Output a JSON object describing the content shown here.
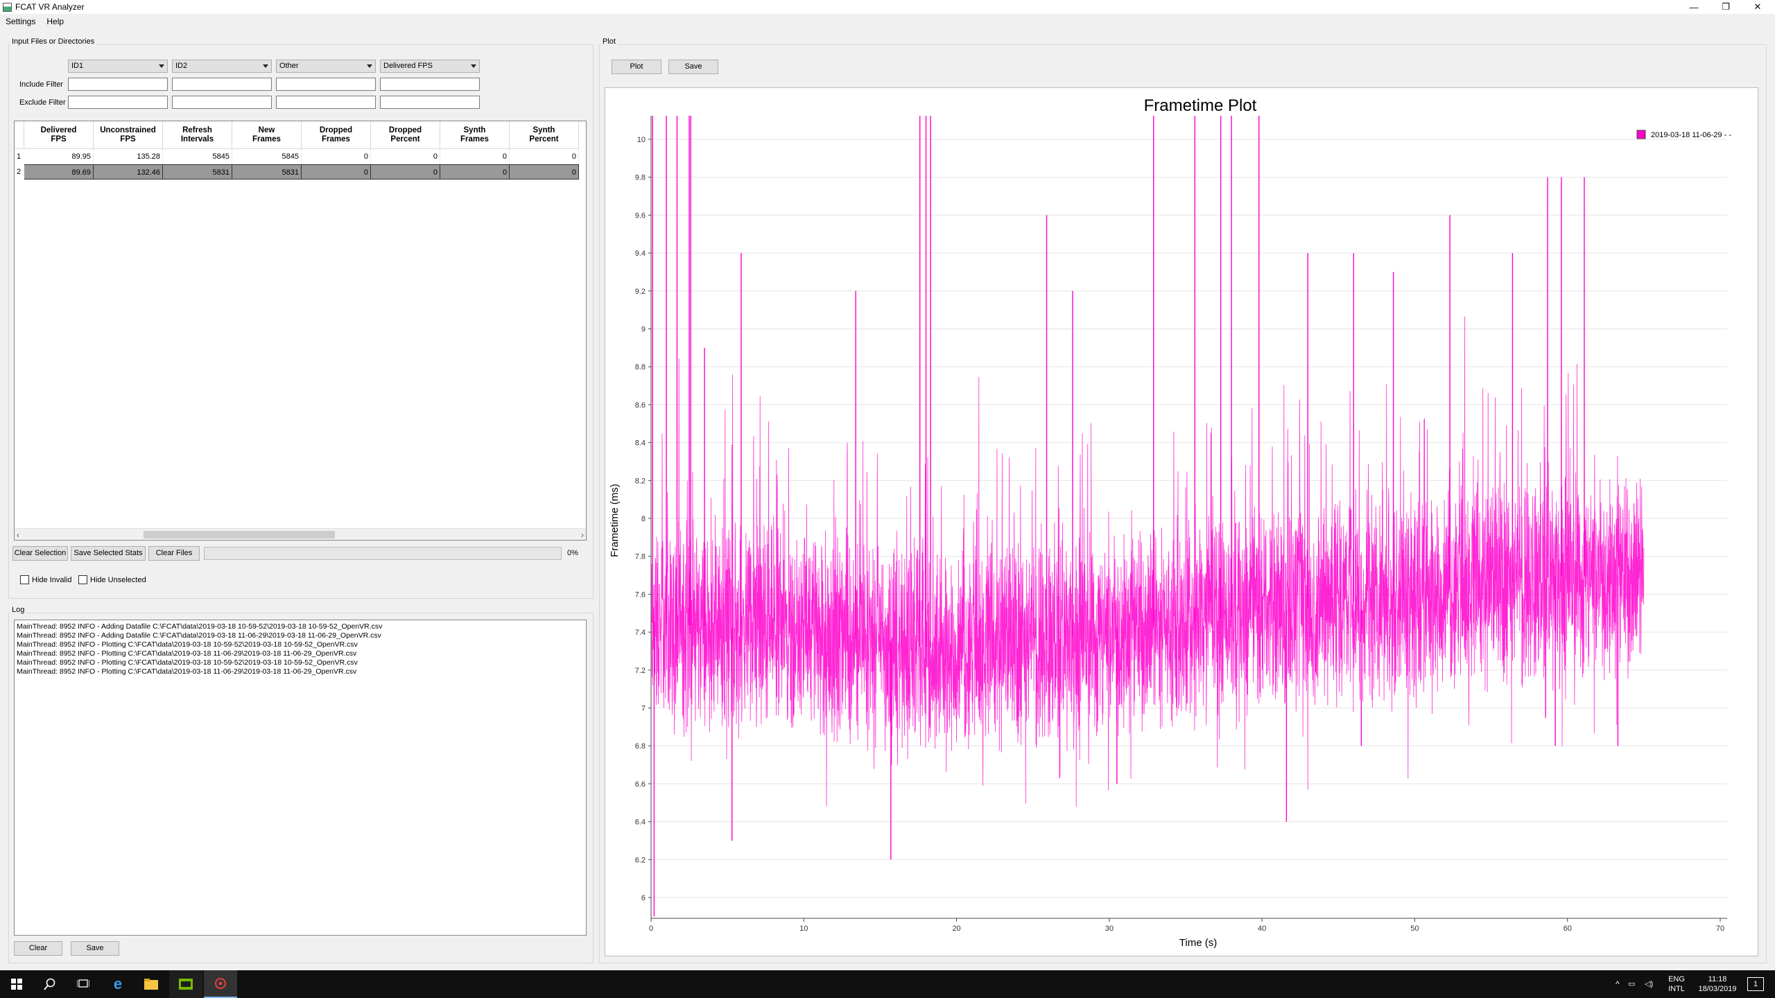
{
  "window": {
    "title": "FCAT VR Analyzer",
    "minimize": "—",
    "restore": "❐",
    "close": "✕"
  },
  "menu": [
    {
      "label": "Settings"
    },
    {
      "label": "Help"
    }
  ],
  "input_group": {
    "title": "Input Files or Directories",
    "combos": [
      "ID1",
      "ID2",
      "Other",
      "Delivered FPS"
    ],
    "include_label": "Include Filter",
    "exclude_label": "Exclude Filter",
    "include_values": [
      "",
      "",
      "",
      ""
    ],
    "exclude_values": [
      "",
      "",
      "",
      ""
    ]
  },
  "table": {
    "headers": [
      [
        "Delivered",
        "FPS"
      ],
      [
        "Unconstrained",
        "FPS"
      ],
      [
        "Refresh",
        "Intervals"
      ],
      [
        "New",
        "Frames"
      ],
      [
        "Dropped",
        "Frames"
      ],
      [
        "Dropped",
        "Percent"
      ],
      [
        "Synth",
        "Frames"
      ],
      [
        "Synth",
        "Percent"
      ]
    ],
    "rows": [
      {
        "id": "1",
        "cells": [
          "89.95",
          "135.28",
          "5845",
          "5845",
          "0",
          "0",
          "0",
          "0"
        ],
        "selected": false
      },
      {
        "id": "2",
        "cells": [
          "89.69",
          "132.46",
          "5831",
          "5831",
          "0",
          "0",
          "0",
          "0"
        ],
        "selected": true
      }
    ]
  },
  "buttons": {
    "clear_selection": "Clear Selection",
    "save_selected": "Save Selected Stats",
    "clear_files": "Clear Files",
    "plot": "Plot",
    "save_plot": "Save",
    "log_clear": "Clear",
    "log_save": "Save"
  },
  "progress": {
    "label": "0%",
    "value": 0
  },
  "checkboxes": {
    "hide_invalid": "Hide Invalid",
    "hide_unselected": "Hide Unselected"
  },
  "log": {
    "title": "Log",
    "lines": [
      "MainThread:  8952  INFO - Adding Datafile C:\\FCAT\\data\\2019-03-18 10-59-52\\2019-03-18 10-59-52_OpenVR.csv",
      "MainThread:  8952  INFO - Adding Datafile C:\\FCAT\\data\\2019-03-18 11-06-29\\2019-03-18 11-06-29_OpenVR.csv",
      "MainThread:  8952  INFO - Plotting C:\\FCAT\\data\\2019-03-18 10-59-52\\2019-03-18 10-59-52_OpenVR.csv",
      "MainThread:  8952  INFO - Plotting C:\\FCAT\\data\\2019-03-18 11-06-29\\2019-03-18 11-06-29_OpenVR.csv",
      "MainThread:  8952  INFO - Plotting C:\\FCAT\\data\\2019-03-18 10-59-52\\2019-03-18 10-59-52_OpenVR.csv",
      "MainThread:  8952  INFO - Plotting C:\\FCAT\\data\\2019-03-18 11-06-29\\2019-03-18 11-06-29_OpenVR.csv"
    ]
  },
  "plot_group": {
    "title": "Plot"
  },
  "chart_data": {
    "type": "line",
    "title": "Frametime Plot",
    "xlabel": "Time (s)",
    "ylabel": "Frametime (ms)",
    "xlim": [
      0,
      70
    ],
    "ylim": [
      5.9,
      10.2
    ],
    "x_ticks": [
      0,
      10,
      20,
      30,
      40,
      50,
      60,
      70
    ],
    "y_ticks": [
      6,
      6.2,
      6.4,
      6.6,
      6.8,
      7,
      7.2,
      7.4,
      7.6,
      7.8,
      8,
      8.2,
      8.4,
      8.6,
      8.8,
      9,
      9.2,
      9.4,
      9.6,
      9.8,
      10
    ],
    "grid": true,
    "legend_position": "top-right",
    "series": [
      {
        "name": "2019-03-18 11-06-29 - -",
        "color": "#ff00cc",
        "x_range": [
          0,
          65
        ],
        "baseline_trend": [
          [
            0,
            7.45
          ],
          [
            10,
            7.4
          ],
          [
            20,
            7.3
          ],
          [
            30,
            7.4
          ],
          [
            40,
            7.5
          ],
          [
            50,
            7.6
          ],
          [
            60,
            7.7
          ],
          [
            65,
            7.7
          ]
        ],
        "spikes": [
          [
            0.1,
            10.2
          ],
          [
            1,
            10.2
          ],
          [
            1.7,
            10.2
          ],
          [
            2.5,
            10.2
          ],
          [
            2.6,
            10.2
          ],
          [
            3.5,
            8.9
          ],
          [
            5.9,
            9.4
          ],
          [
            13.4,
            9.2
          ],
          [
            17.6,
            10.2
          ],
          [
            18,
            10.2
          ],
          [
            18.3,
            10.2
          ],
          [
            25.9,
            9.6
          ],
          [
            27.6,
            9.2
          ],
          [
            32.9,
            10.2
          ],
          [
            35.6,
            10.2
          ],
          [
            37.3,
            10.2
          ],
          [
            38,
            10.2
          ],
          [
            39.8,
            10.2
          ],
          [
            43,
            9.4
          ],
          [
            46,
            9.4
          ],
          [
            48.6,
            9.3
          ],
          [
            52.3,
            9.6
          ],
          [
            56.4,
            9.4
          ],
          [
            58.7,
            9.8
          ],
          [
            59.6,
            9.8
          ],
          [
            61.1,
            9.8
          ]
        ],
        "dips": [
          [
            0.2,
            5.9
          ],
          [
            5.3,
            6.3
          ],
          [
            15.7,
            6.2
          ],
          [
            30.5,
            6.6
          ],
          [
            41.6,
            6.4
          ],
          [
            46.5,
            6.8
          ],
          [
            59.2,
            6.8
          ],
          [
            63.3,
            6.8
          ]
        ]
      }
    ]
  },
  "taskbar": {
    "icons": [
      "windows-start",
      "search",
      "task-view",
      "edge",
      "file-explorer",
      "nvidia",
      "fcat"
    ],
    "lang_top": "ENG",
    "lang_bottom": "INTL",
    "time": "11:18",
    "date": "18/03/2019",
    "tray_up": "^",
    "notify": "1"
  }
}
